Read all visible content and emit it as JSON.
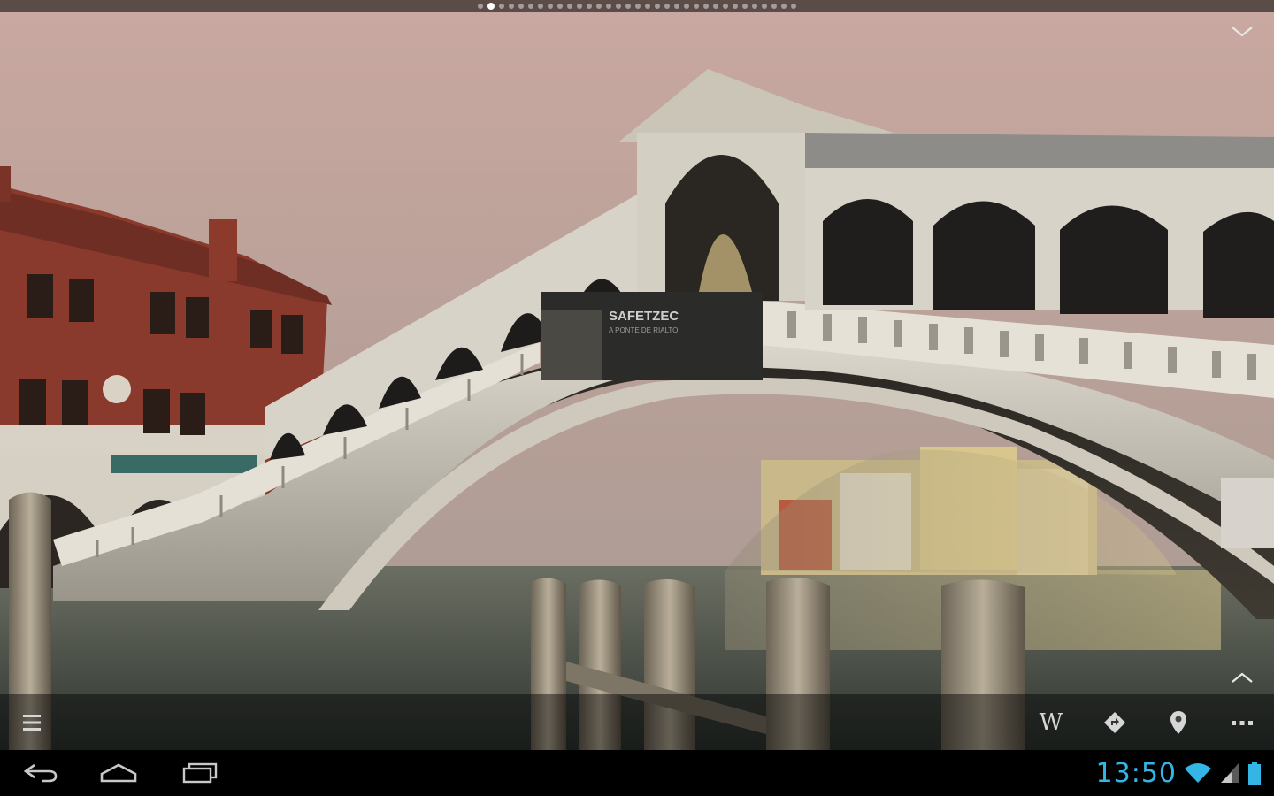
{
  "banner": {
    "title": "SAFETZEC",
    "subtitle": "A PONTE DE RIALTO"
  },
  "page_indicator": {
    "count": 33,
    "active_index": 1
  },
  "toolbar": {
    "wikipedia_label": "W"
  },
  "status_bar": {
    "time": "13:50"
  },
  "icons": {
    "menu": "menu-icon",
    "wikipedia": "wikipedia-icon",
    "directions": "directions-icon",
    "location": "location-pin-icon",
    "overflow": "overflow-icon",
    "back": "back-icon",
    "home": "home-icon",
    "recents": "recents-icon",
    "wifi": "wifi-icon",
    "signal": "signal-icon",
    "battery": "battery-icon",
    "collapse": "chevron-down-icon",
    "expand": "chevron-up-icon"
  },
  "colors": {
    "clock": "#33b5e5",
    "toolbar_icon": "#d6d6d6"
  }
}
